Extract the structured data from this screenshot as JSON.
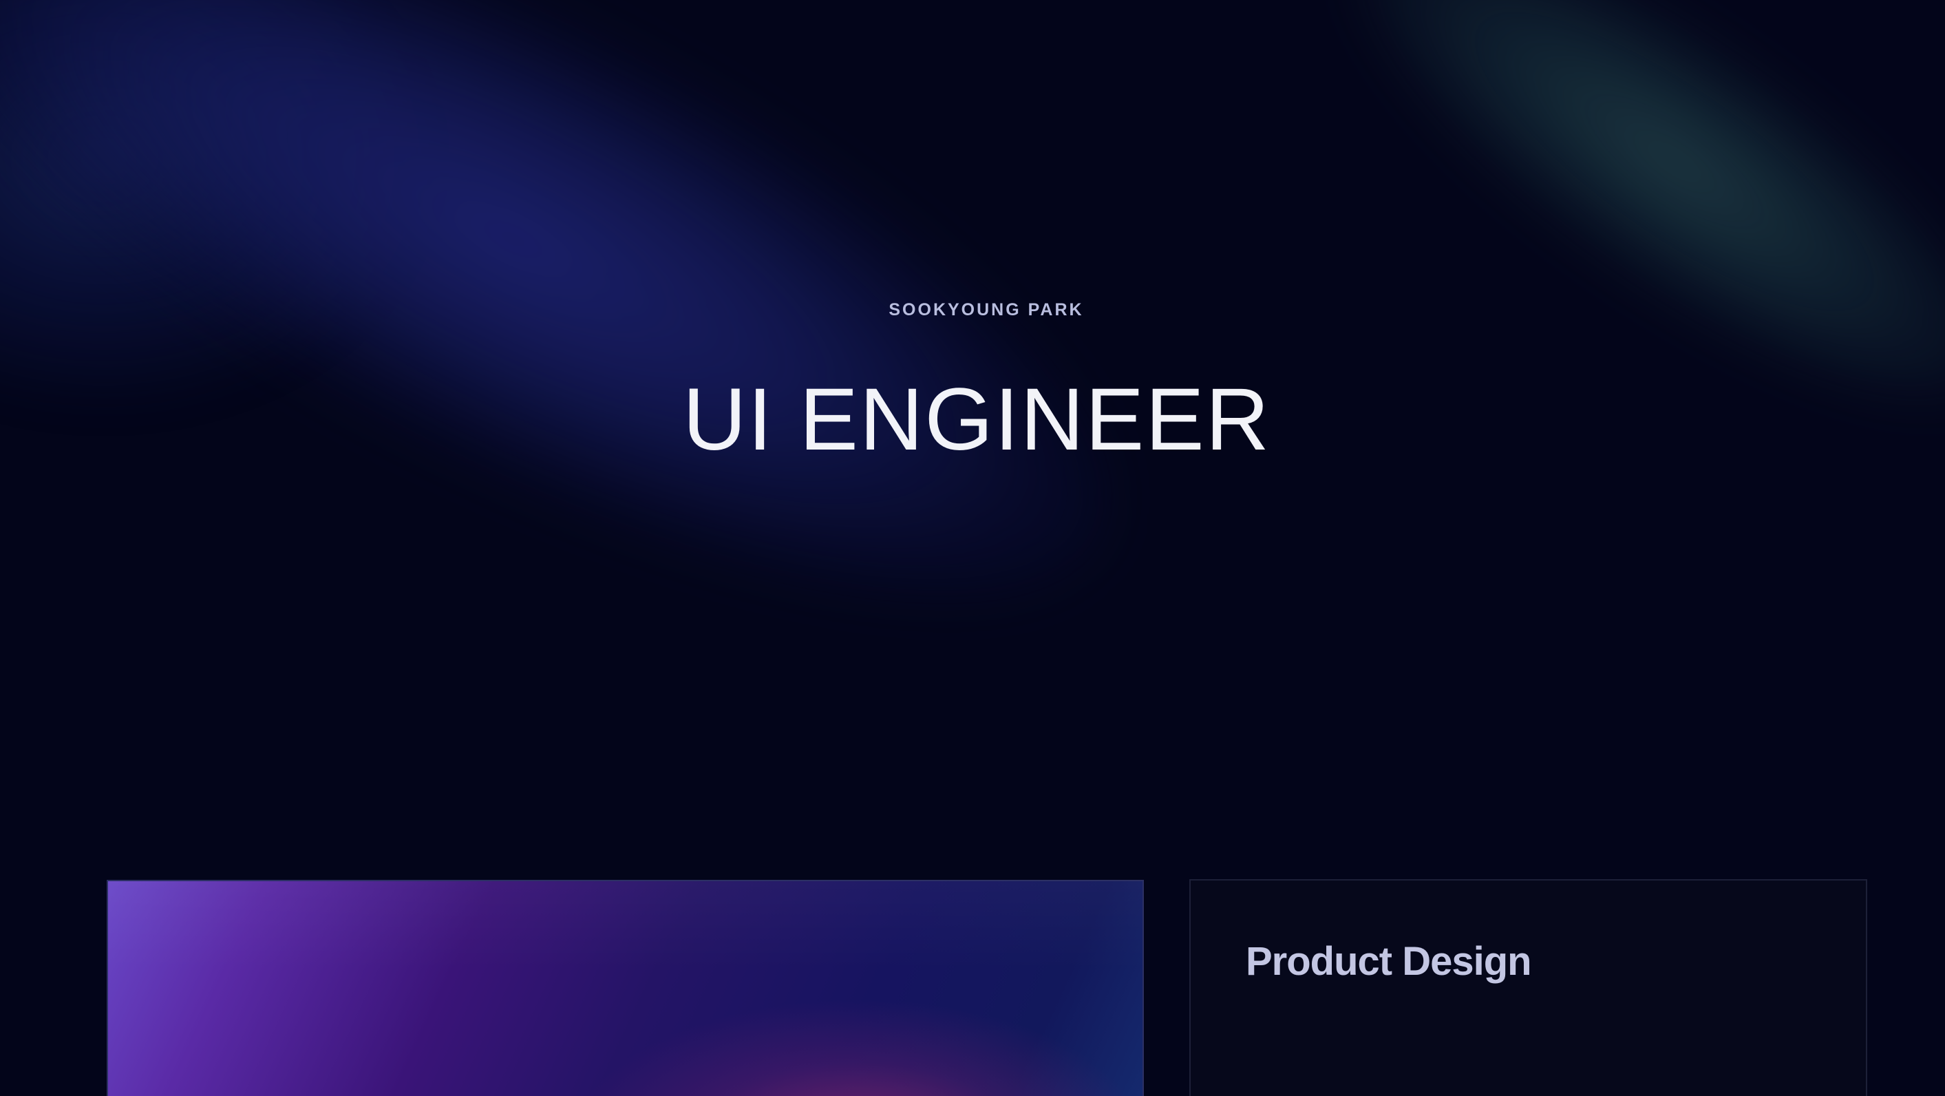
{
  "hero": {
    "eyebrow": "SOOKYOUNG PARK",
    "title": "UI ENGINEER"
  },
  "cards": [
    {
      "type": "image"
    },
    {
      "type": "text",
      "title": "Product Design"
    }
  ],
  "colors": {
    "background": "#03051a",
    "glow_blue": "#1c206e",
    "glow_teal": "#214048",
    "eyebrow": "#b9bedf",
    "title": "#f2f3f8",
    "card_title": "#c3c6e3",
    "card_border": "#1d2038"
  }
}
